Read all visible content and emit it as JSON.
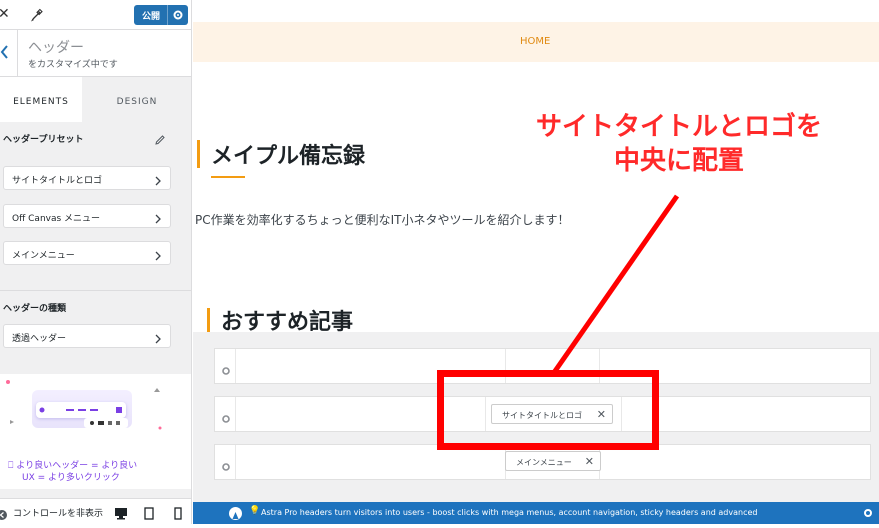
{
  "topbar": {
    "publish_label": "公開"
  },
  "panel": {
    "title": "ヘッダー",
    "subtitle": "をカスタマイズ中です"
  },
  "tabs": [
    {
      "label": "ELEMENTS"
    },
    {
      "label": "DESIGN"
    }
  ],
  "presets": {
    "title": "ヘッダープリセット"
  },
  "items": [
    {
      "label": "サイトタイトルとロゴ"
    },
    {
      "label": "Off Canvas メニュー"
    },
    {
      "label": "メインメニュー"
    }
  ],
  "header_type": {
    "title": "ヘッダーの種類",
    "item": "透過ヘッダー"
  },
  "promo": {
    "line1": "より良いヘッダー = より良い",
    "line2": "UX = より多いクリック"
  },
  "footer": {
    "hide_controls": "コントロールを非表示"
  },
  "preview": {
    "nav_home": "HOME",
    "site_title": "メイプル備忘録",
    "tagline": "PC作業を効率化するちょっと便利なIT小ネタやツールを紹介します！",
    "section_title": "おすすめ記事"
  },
  "builder": {
    "chip_site_title": "サイトタイトルとロゴ",
    "chip_main_menu": "メインメニュー"
  },
  "annotation": {
    "line1": "サイトタイトルとロゴを",
    "line2": "中央に配置"
  },
  "pro_bar": {
    "text": "Astra Pro headers turn visitors into users - boost clicks with mega menus, account navigation, sticky headers and advanced"
  },
  "colors": {
    "accent": "#2271b1",
    "orange": "#f39c12",
    "annotation_red": "#ff0000",
    "promo_purple": "#7a3fe4"
  }
}
